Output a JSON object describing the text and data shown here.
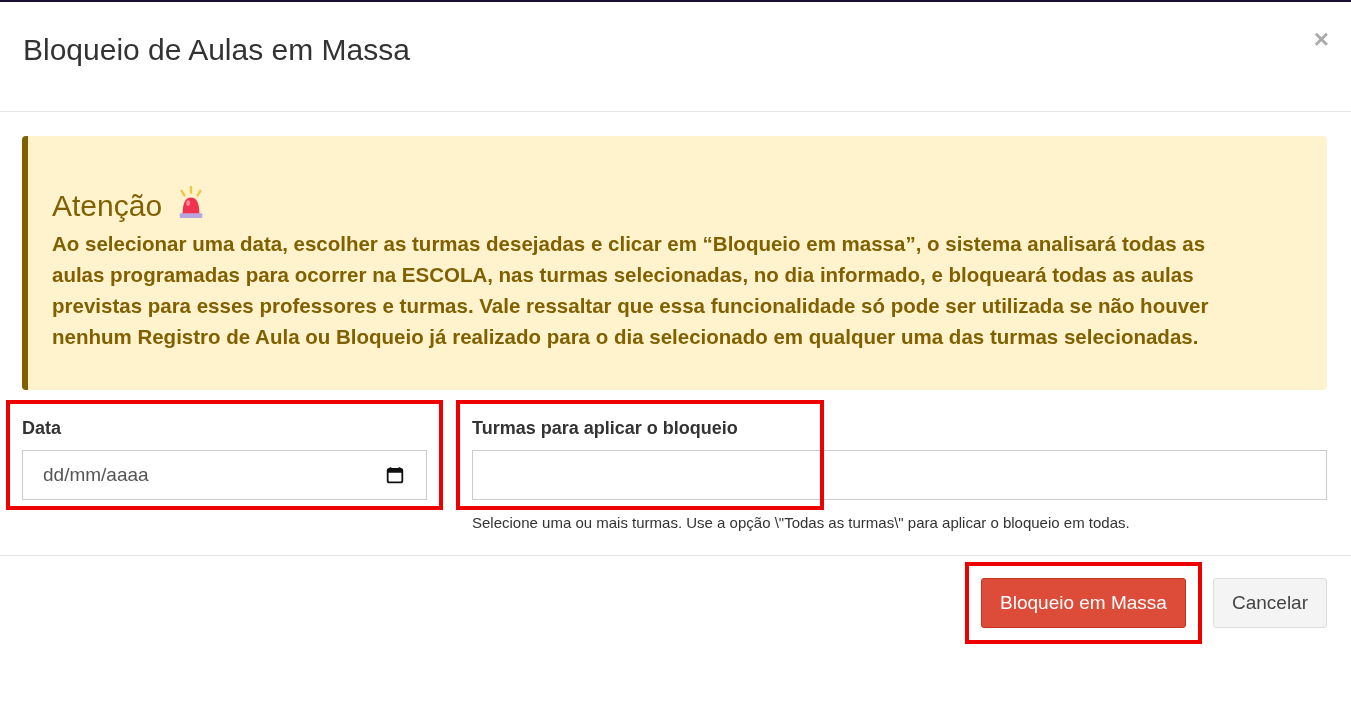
{
  "modal": {
    "title": "Bloqueio de Aulas em Massa",
    "close": "×"
  },
  "alert": {
    "title": "Atenção",
    "text": "Ao selecionar uma data, escolher as turmas desejadas e clicar em “Bloqueio em massa”, o sistema analisará todas as aulas programadas para ocorrer na ESCOLA, nas turmas selecionadas, no dia informado, e bloqueará todas as aulas previstas para esses professores e turmas. Vale ressaltar que essa funcionalidade só pode ser utilizada se não houver nenhum Registro de Aula ou Bloqueio já realizado para o dia selecionado em qualquer uma das turmas selecionadas."
  },
  "fields": [
    {
      "kind": "date",
      "label": "Data",
      "placeholder": "dd/mm/aaaa",
      "highlighted": true
    },
    {
      "kind": "select",
      "label": "Turmas para aplicar o bloqueio",
      "help": "Selecione uma ou mais turmas. Use a opção \\\"Todas as turmas\\\" para aplicar o bloqueio em todas.",
      "highlighted": true
    }
  ],
  "buttons": [
    {
      "kind": "primary",
      "label": "Bloqueio em Massa",
      "highlighted": true
    },
    {
      "kind": "secondary",
      "label": "Cancelar"
    }
  ]
}
